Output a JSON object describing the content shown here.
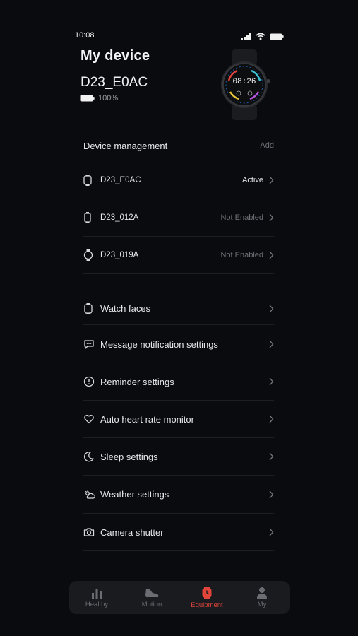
{
  "status": {
    "time": "10:08"
  },
  "header": {
    "title": "My device",
    "device_name": "D23_E0AC",
    "battery": "100%",
    "watch_time": "08:26"
  },
  "device_management": {
    "label": "Device management",
    "add_label": "Add",
    "devices": [
      {
        "name": "D23_E0AC",
        "status": "Active",
        "icon": "square-watch-icon"
      },
      {
        "name": "D23_012A",
        "status": "Not Enabled",
        "icon": "slim-watch-icon"
      },
      {
        "name": "D23_019A",
        "status": "Not Enabled",
        "icon": "round-watch-icon"
      }
    ]
  },
  "settings": [
    {
      "label": "Watch faces",
      "icon": "watch-face-icon"
    },
    {
      "label": "Message notification settings",
      "icon": "message-icon"
    },
    {
      "label": "Reminder settings",
      "icon": "reminder-icon"
    },
    {
      "label": "Auto heart rate monitor",
      "icon": "heart-icon"
    },
    {
      "label": "Sleep settings",
      "icon": "moon-icon"
    },
    {
      "label": "Weather settings",
      "icon": "weather-icon"
    },
    {
      "label": "Camera shutter",
      "icon": "camera-icon"
    }
  ],
  "tabs": [
    {
      "label": "Healthy",
      "icon": "chart-icon",
      "active": false
    },
    {
      "label": "Motion",
      "icon": "shoe-icon",
      "active": false
    },
    {
      "label": "Equipment",
      "icon": "watch-icon",
      "active": true
    },
    {
      "label": "My",
      "icon": "user-icon",
      "active": false
    }
  ],
  "colors": {
    "accent": "#e0443a",
    "background": "#0a0b0e",
    "text": "#e6e7ea",
    "muted": "#6e7076"
  }
}
